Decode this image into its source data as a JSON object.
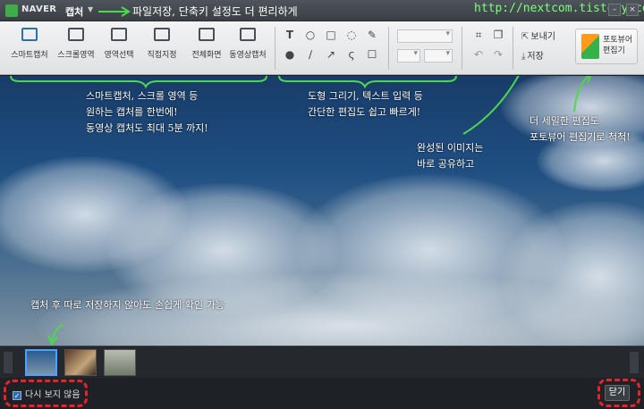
{
  "titlebar": {
    "brand": "NAVER",
    "app_name": "캡처",
    "annotation": "파일저장, 단축키 설정도 더 편리하게",
    "watermark": "http://nextcom.tistory.com"
  },
  "toolbar": {
    "capture_tools": [
      {
        "label": "스마트캡처",
        "icon": "smart-capture-icon"
      },
      {
        "label": "스크롤영역",
        "icon": "scroll-area-icon"
      },
      {
        "label": "영역선택",
        "icon": "area-select-icon"
      },
      {
        "label": "직접지정",
        "icon": "direct-select-icon"
      },
      {
        "label": "전체화면",
        "icon": "fullscreen-icon"
      },
      {
        "label": "동영상캡처",
        "icon": "video-capture-icon"
      }
    ],
    "send_label": "보내기",
    "save_label": "저장",
    "photo_editor_label": "포토뷰어 편집기"
  },
  "notes": {
    "capture": [
      "스마트캡처, 스크롤 영역 등",
      "원하는 캡처를 한번에!",
      "동영상 캡처도 최대 5분 까지!"
    ],
    "editing": [
      "도형 그리기, 텍스트 입력 등",
      "간단한 편집도 쉽고 빠르게!"
    ],
    "share": [
      "완성된 이미지는",
      "바로 공유하고"
    ],
    "detail": [
      "더 세밀한 편집도",
      "포토뷰어 편집기로 척척!"
    ],
    "history": "캡처 후 따로 저장하지 않아도 손쉽게 확인 가능"
  },
  "statusbar": {
    "dont_show_label": "다시 보지 않음",
    "close_label": "닫기"
  },
  "colors": {
    "annotation_arrow": "#4cd94c",
    "highlight_dash": "#e8232a",
    "selected_thumb": "#4aa3ff"
  }
}
